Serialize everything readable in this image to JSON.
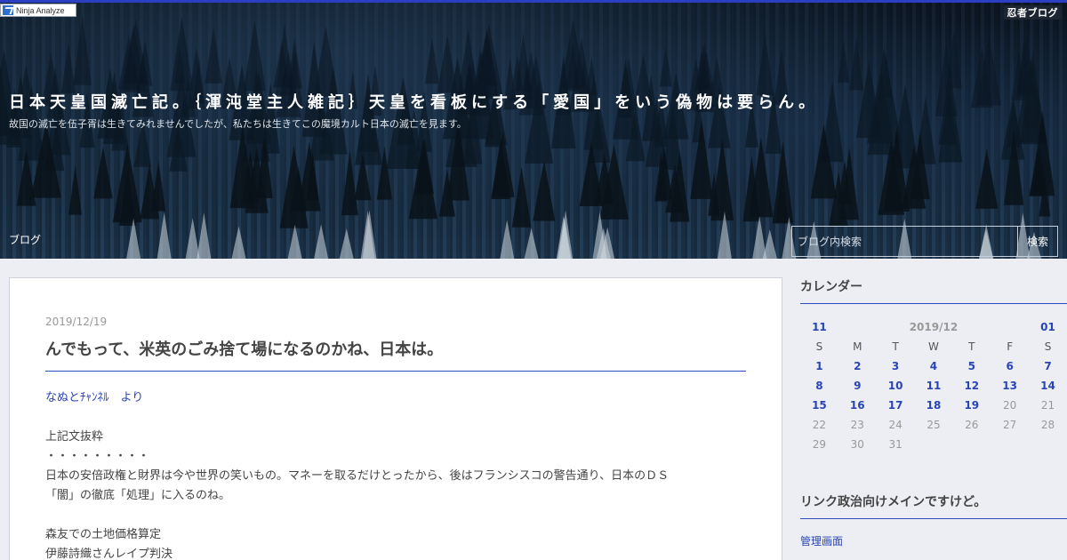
{
  "header": {
    "ninja_analyze": "Ninja Analyze",
    "ninja_logo": "忍者ブログ",
    "title": "日本天皇国滅亡記。｛渾沌堂主人雑記｝天皇を看板にする「愛国」をいう偽物は要らん。",
    "description": "故国の滅亡を伍子胥は生きてみれませんでしたが、私たちは生きてこの魔境カルト日本の滅亡を見ます。",
    "nav_blog": "ブログ",
    "search_placeholder": "ブログ内検索",
    "search_button": "検索"
  },
  "post": {
    "date": "2019/12/19",
    "title": "んでもって、米英のごみ捨て場になるのかね、日本は。",
    "source_link": "なぬとﾁｬﾝﾈﾙ　より",
    "lines": [
      "",
      "上記文抜粋",
      "・・・・・・・・・",
      "日本の安倍政権と財界は今や世界の笑いもの。マネーを取るだけとったから、後はフランシスコの警告通り、日本のＤＳ",
      "「闇」の徹底「処理」に入るのね。",
      "",
      "森友での土地価格算定",
      "伊藤詩織さんレイプ判決"
    ]
  },
  "sidebar": {
    "calendar_heading": "カレンダー",
    "calendar": {
      "prev": "11",
      "month": "2019/12",
      "next": "01",
      "weekdays": [
        "S",
        "M",
        "T",
        "W",
        "T",
        "F",
        "S"
      ],
      "weeks": [
        [
          "1",
          "2",
          "3",
          "4",
          "5",
          "6",
          "7"
        ],
        [
          "8",
          "9",
          "10",
          "11",
          "12",
          "13",
          "14"
        ],
        [
          "15",
          "16",
          "17",
          "18",
          "19",
          "20",
          "21"
        ],
        [
          "22",
          "23",
          "24",
          "25",
          "26",
          "27",
          "28"
        ],
        [
          "29",
          "30",
          "31",
          "",
          "",
          "",
          ""
        ]
      ],
      "linked_days": [
        "1",
        "2",
        "3",
        "4",
        "5",
        "6",
        "7",
        "8",
        "9",
        "10",
        "11",
        "12",
        "13",
        "14",
        "15",
        "16",
        "17",
        "18",
        "19"
      ]
    },
    "links_heading": "リンク政治向けメインですけど。",
    "admin_link": "管理画面"
  },
  "colors": {
    "accent": "#2b3fc4",
    "link": "#2a44b6",
    "background": "#eceef3"
  }
}
